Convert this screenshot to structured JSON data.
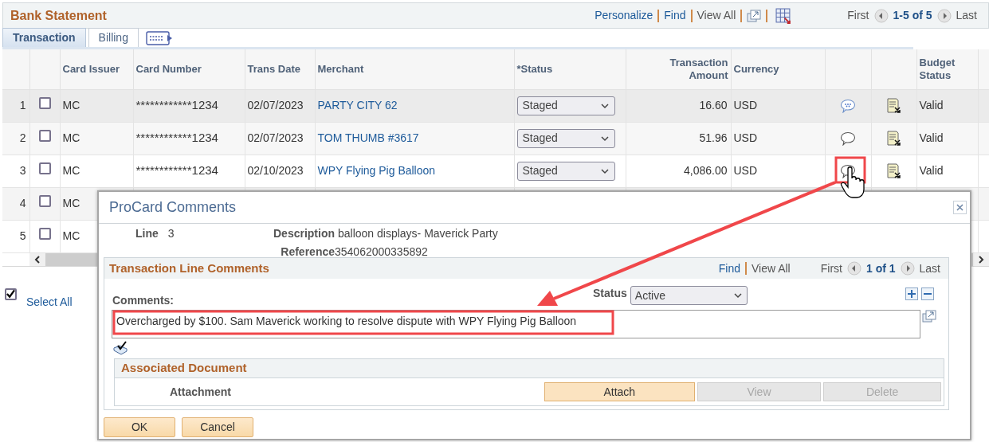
{
  "panel": {
    "title": "Bank Statement",
    "nav": {
      "personalize": "Personalize",
      "find": "Find",
      "view_all": "View All",
      "first": "First",
      "range": "1-5 of 5",
      "last": "Last"
    }
  },
  "tabs": [
    {
      "label": "Transaction",
      "selected": true
    },
    {
      "label": "Billing",
      "selected": false
    }
  ],
  "table": {
    "columns": [
      "Card Issuer",
      "Card Number",
      "Trans Date",
      "Merchant",
      "*Status",
      "Transaction Amount",
      "Currency",
      "Budget Status"
    ],
    "rows": [
      {
        "num": "1",
        "checked": false,
        "issuer": "MC",
        "card": "************1234",
        "date": "02/07/2023",
        "merchant": "PARTY CITY 62",
        "status": "Staged",
        "amount": "16.60",
        "currency": "USD",
        "has_comment": true,
        "budget": "Valid"
      },
      {
        "num": "2",
        "checked": false,
        "issuer": "MC",
        "card": "************1234",
        "date": "02/07/2023",
        "merchant": "TOM THUMB #3617",
        "status": "Staged",
        "amount": "51.96",
        "currency": "USD",
        "has_comment": false,
        "budget": "Valid"
      },
      {
        "num": "3",
        "checked": false,
        "issuer": "MC",
        "card": "************1234",
        "date": "02/10/2023",
        "merchant": "WPY Flying Pig Balloon",
        "status": "Staged",
        "amount": "4,086.00",
        "currency": "USD",
        "has_comment": false,
        "budget": "Valid"
      },
      {
        "num": "4",
        "checked": false,
        "issuer": "MC"
      },
      {
        "num": "5",
        "checked": false,
        "issuer": "MC"
      }
    ]
  },
  "select_all": {
    "label": "Select All",
    "checked": true
  },
  "dialog": {
    "title": "ProCard Comments",
    "fields": [
      {
        "label": "Line",
        "value": "3"
      },
      {
        "label": "Description",
        "value": "balloon displays- Maverick Party"
      },
      {
        "label": "Reference",
        "value": "354062000335892"
      }
    ],
    "section": {
      "title": "Transaction Line Comments",
      "nav": {
        "find": "Find",
        "view_all": "View All",
        "first": "First",
        "range": "1 of 1",
        "last": "Last"
      },
      "comments_label": "Comments:",
      "status_label": "Status",
      "status_value": "Active",
      "comment": "Overcharged by $100. Sam Maverick working to resolve dispute with WPY Flying Pig Balloon",
      "documents": {
        "title": "Associated Document",
        "label": "Attachment",
        "buttons": [
          {
            "label": "Attach",
            "disabled": false
          },
          {
            "label": "View",
            "disabled": true
          },
          {
            "label": "Delete",
            "disabled": true
          }
        ]
      }
    },
    "buttons": [
      "OK",
      "Cancel"
    ]
  }
}
